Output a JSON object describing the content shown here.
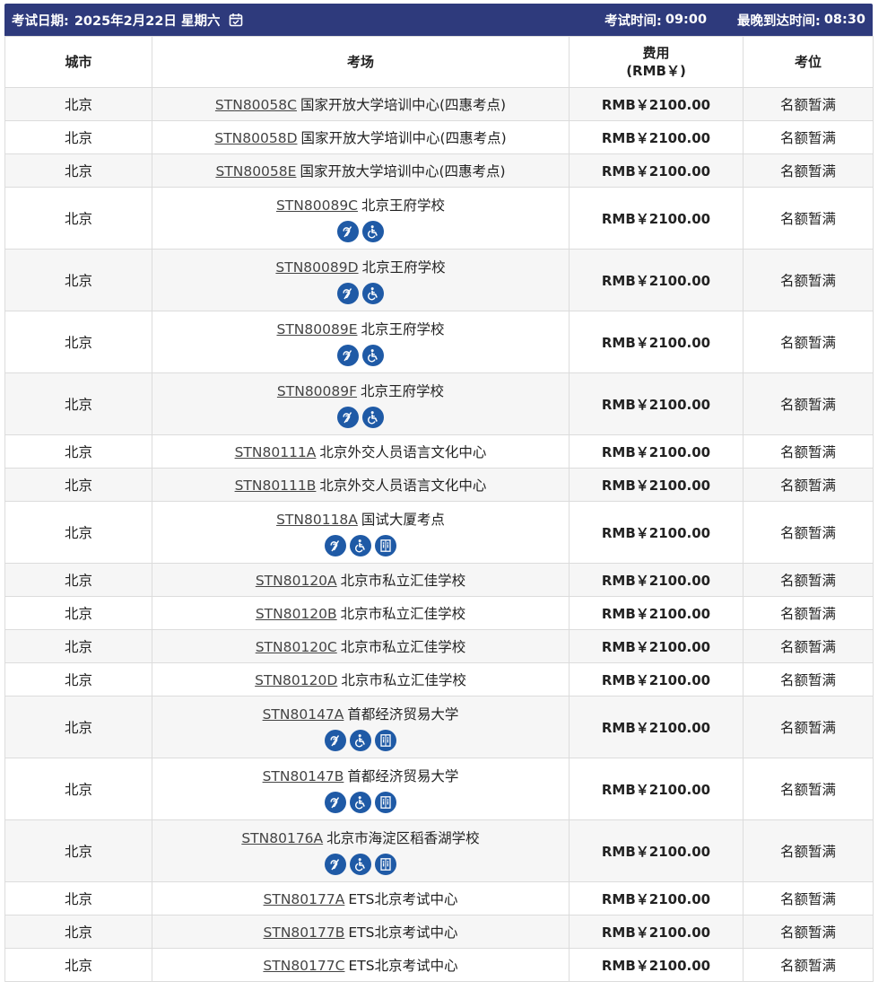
{
  "header": {
    "date_label": "考试日期:",
    "date_value": "2025年2月22日 星期六",
    "exam_time_label": "考试时间:",
    "exam_time_value": "09:00",
    "latest_arrival_label": "最晚到达时间:",
    "latest_arrival_value": "08:30"
  },
  "columns": {
    "city": "城市",
    "venue": "考场",
    "fee_line1": "费用",
    "fee_line2": "(RMB￥)",
    "seats": "考位"
  },
  "rows": [
    {
      "city": "北京",
      "code": "STN80058C",
      "name": "国家开放大学培训中心(四惠考点)",
      "fee": "RMB￥2100.00",
      "seats": "名额暂满",
      "icons": []
    },
    {
      "city": "北京",
      "code": "STN80058D",
      "name": "国家开放大学培训中心(四惠考点)",
      "fee": "RMB￥2100.00",
      "seats": "名额暂满",
      "icons": []
    },
    {
      "city": "北京",
      "code": "STN80058E",
      "name": "国家开放大学培训中心(四惠考点)",
      "fee": "RMB￥2100.00",
      "seats": "名额暂满",
      "icons": []
    },
    {
      "city": "北京",
      "code": "STN80089C",
      "name": "北京王府学校",
      "fee": "RMB￥2100.00",
      "seats": "名额暂满",
      "icons": [
        "hearing-icon",
        "wheelchair-icon"
      ]
    },
    {
      "city": "北京",
      "code": "STN80089D",
      "name": "北京王府学校",
      "fee": "RMB￥2100.00",
      "seats": "名额暂满",
      "icons": [
        "hearing-icon",
        "wheelchair-icon"
      ]
    },
    {
      "city": "北京",
      "code": "STN80089E",
      "name": "北京王府学校",
      "fee": "RMB￥2100.00",
      "seats": "名额暂满",
      "icons": [
        "hearing-icon",
        "wheelchair-icon"
      ]
    },
    {
      "city": "北京",
      "code": "STN80089F",
      "name": "北京王府学校",
      "fee": "RMB￥2100.00",
      "seats": "名额暂满",
      "icons": [
        "hearing-icon",
        "wheelchair-icon"
      ]
    },
    {
      "city": "北京",
      "code": "STN80111A",
      "name": "北京外交人员语言文化中心",
      "fee": "RMB￥2100.00",
      "seats": "名额暂满",
      "icons": []
    },
    {
      "city": "北京",
      "code": "STN80111B",
      "name": "北京外交人员语言文化中心",
      "fee": "RMB￥2100.00",
      "seats": "名额暂满",
      "icons": []
    },
    {
      "city": "北京",
      "code": "STN80118A",
      "name": "国试大厦考点",
      "fee": "RMB￥2100.00",
      "seats": "名额暂满",
      "icons": [
        "hearing-icon",
        "wheelchair-icon",
        "elevator-icon"
      ]
    },
    {
      "city": "北京",
      "code": "STN80120A",
      "name": "北京市私立汇佳学校",
      "fee": "RMB￥2100.00",
      "seats": "名额暂满",
      "icons": []
    },
    {
      "city": "北京",
      "code": "STN80120B",
      "name": "北京市私立汇佳学校",
      "fee": "RMB￥2100.00",
      "seats": "名额暂满",
      "icons": []
    },
    {
      "city": "北京",
      "code": "STN80120C",
      "name": "北京市私立汇佳学校",
      "fee": "RMB￥2100.00",
      "seats": "名额暂满",
      "icons": []
    },
    {
      "city": "北京",
      "code": "STN80120D",
      "name": "北京市私立汇佳学校",
      "fee": "RMB￥2100.00",
      "seats": "名额暂满",
      "icons": []
    },
    {
      "city": "北京",
      "code": "STN80147A",
      "name": "首都经济贸易大学",
      "fee": "RMB￥2100.00",
      "seats": "名额暂满",
      "icons": [
        "hearing-icon",
        "wheelchair-icon",
        "elevator-icon"
      ]
    },
    {
      "city": "北京",
      "code": "STN80147B",
      "name": "首都经济贸易大学",
      "fee": "RMB￥2100.00",
      "seats": "名额暂满",
      "icons": [
        "hearing-icon",
        "wheelchair-icon",
        "elevator-icon"
      ]
    },
    {
      "city": "北京",
      "code": "STN80176A",
      "name": "北京市海淀区稻香湖学校",
      "fee": "RMB￥2100.00",
      "seats": "名额暂满",
      "icons": [
        "hearing-icon",
        "wheelchair-icon",
        "elevator-icon"
      ]
    },
    {
      "city": "北京",
      "code": "STN80177A",
      "name": "ETS北京考试中心",
      "fee": "RMB￥2100.00",
      "seats": "名额暂满",
      "icons": []
    },
    {
      "city": "北京",
      "code": "STN80177B",
      "name": "ETS北京考试中心",
      "fee": "RMB￥2100.00",
      "seats": "名额暂满",
      "icons": []
    },
    {
      "city": "北京",
      "code": "STN80177C",
      "name": "ETS北京考试中心",
      "fee": "RMB￥2100.00",
      "seats": "名额暂满",
      "icons": []
    }
  ]
}
